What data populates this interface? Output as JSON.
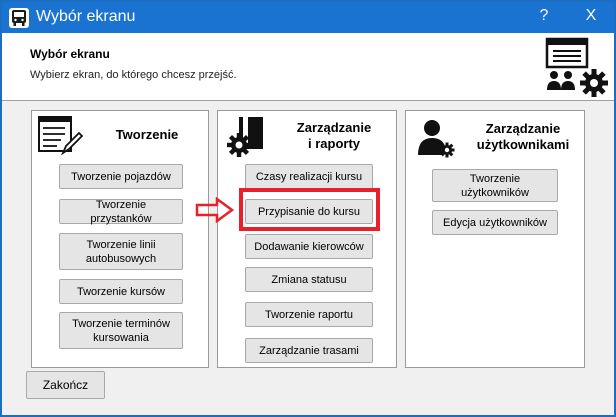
{
  "window": {
    "title": "Wybór ekranu",
    "help_label": "?",
    "close_label": "X"
  },
  "header": {
    "title": "Wybór ekranu",
    "subtitle": "Wybierz ekran, do którego chcesz przejść."
  },
  "groups": {
    "tworzenie": {
      "title": "Tworzenie",
      "buttons": [
        "Tworzenie pojazdów",
        "Tworzenie przystanków",
        "Tworzenie linii autobusowych",
        "Tworzenie kursów",
        "Tworzenie terminów kursowania"
      ]
    },
    "zarzadzanie": {
      "title_line1": "Zarządzanie",
      "title_line2": "i raporty",
      "buttons": [
        "Czasy realizacji kursu",
        "Przypisanie do kursu",
        "Dodawanie kierowców",
        "Zmiana statusu",
        "Tworzenie raportu",
        "Zarządzanie trasami"
      ]
    },
    "uzytkownicy": {
      "title_line1": "Zarządzanie",
      "title_line2": "użytkownikami",
      "buttons": [
        "Tworzenie użytkowników",
        "Edycja użytkowników"
      ]
    }
  },
  "footer": {
    "exit_label": "Zakończ"
  },
  "colors": {
    "titlebar": "#1b73d1",
    "highlight": "#e8202a"
  },
  "icons": [
    "bus-icon",
    "help-icon",
    "close-icon",
    "screen-users-gear-icon",
    "document-pen-icon",
    "document-gear-icon",
    "user-gear-icon",
    "arrow-right-icon"
  ]
}
